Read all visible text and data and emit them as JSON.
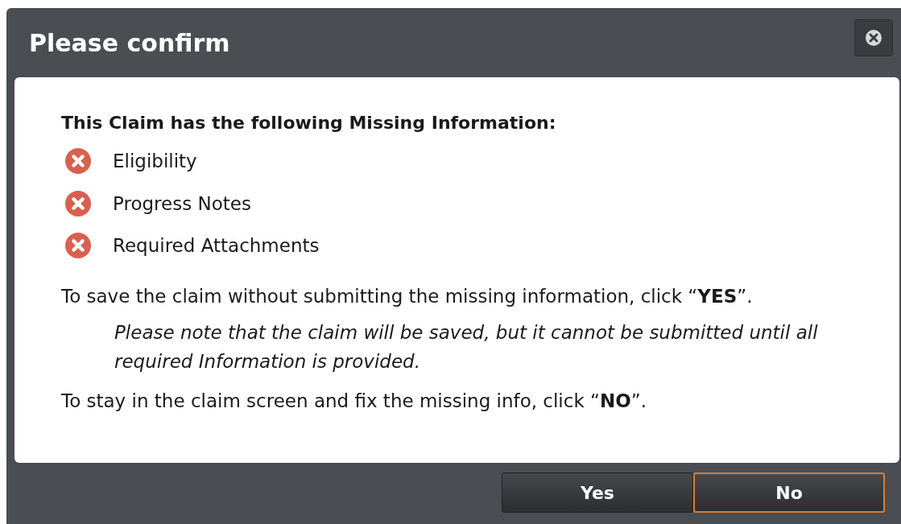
{
  "dialog": {
    "title": "Please confirm",
    "heading": "This Claim has the following Missing Information:",
    "missing_items": [
      {
        "label": "Eligibility"
      },
      {
        "label": "Progress Notes"
      },
      {
        "label": "Required Attachments"
      }
    ],
    "yes_instruction": "To save the claim without submitting the missing information, click “**YES**”.",
    "note": "Please note that the claim will be saved, but it cannot be submitted until all required Information is provided.",
    "no_instruction": "To stay in the claim screen and fix the missing info, click “**NO**”.",
    "buttons": [
      {
        "label": "Yes",
        "selected": false
      },
      {
        "label": "No",
        "selected": true
      }
    ]
  }
}
